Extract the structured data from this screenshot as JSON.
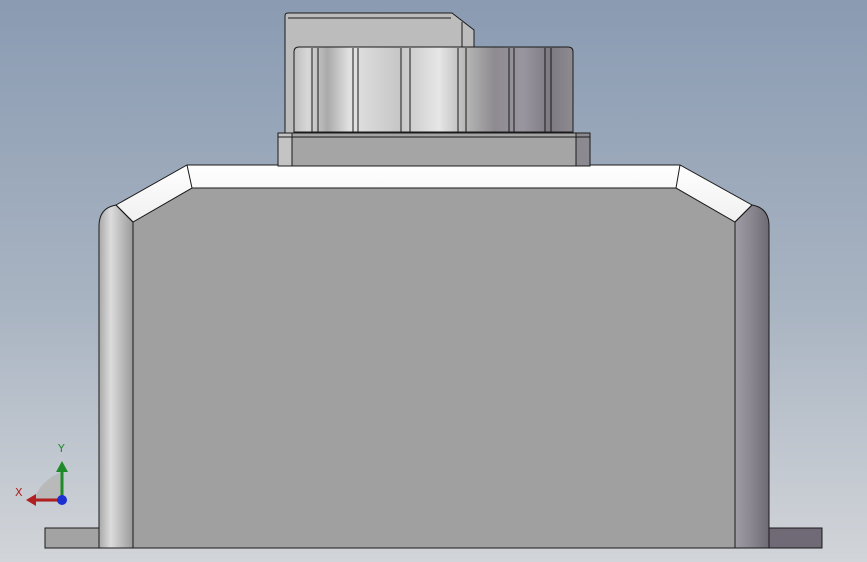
{
  "viewport": {
    "background_top": "#8a9bb2",
    "background_bottom": "#d2d5d9"
  },
  "model": {
    "face_color": "#a0a0a0",
    "edge_color": "#1a1a1a",
    "highlight_color": "#ffffff"
  },
  "triad": {
    "y_label": "Y",
    "x_label": "X",
    "y_color": "#1f8a2a",
    "x_color": "#b02020",
    "z_color": "#1c2fd0"
  }
}
